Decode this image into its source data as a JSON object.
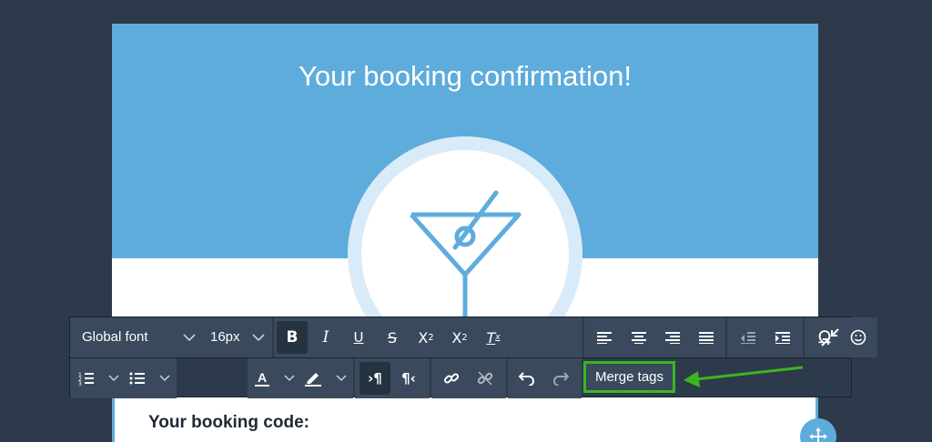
{
  "email": {
    "hero_title": "Your booking confirmation!",
    "body_heading": "Your booking code:",
    "accent_color": "#5eacdc"
  },
  "toolbar": {
    "font_family": "Global font",
    "font_size": "16px",
    "merge_tags_label": "Merge tags",
    "icons_row1": [
      "bold-icon",
      "italic-icon",
      "underline-icon",
      "strikethrough-icon",
      "superscript-icon",
      "subscript-icon",
      "clear-format-icon",
      "align-left-icon",
      "align-center-icon",
      "align-right-icon",
      "align-justify-icon",
      "outdent-icon",
      "indent-icon",
      "special-char-icon",
      "emoji-icon",
      "collapse-icon"
    ],
    "icons_row2": [
      "ordered-list-icon",
      "unordered-list-icon",
      "text-color-icon",
      "highlight-icon",
      "ltr-icon",
      "rtl-icon",
      "link-icon",
      "unlink-icon",
      "undo-icon",
      "redo-icon"
    ]
  },
  "annotation": {
    "color": "#3cb521"
  }
}
